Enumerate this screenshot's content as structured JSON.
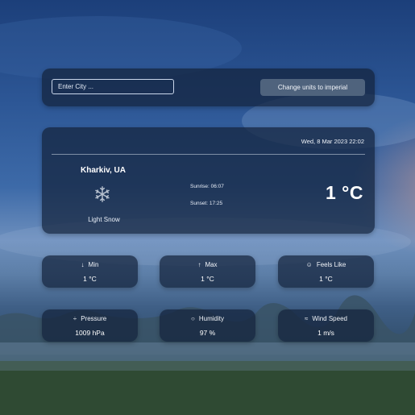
{
  "search": {
    "placeholder": "Enter City ..."
  },
  "toolbar": {
    "units_label": "Change units to imperial"
  },
  "current": {
    "datetime": "Wed, 8 Mar 2023 22:02",
    "city": "Kharkiv, UA",
    "icon": "snowflake-icon",
    "condition": "Light Snow",
    "sunrise": "Sunrise: 06:07",
    "sunset": "Sunset: 17:25",
    "temperature": "1 °C"
  },
  "details": [
    {
      "label": "Min",
      "icon": "arrow-down-icon",
      "value": "1 °C"
    },
    {
      "label": "Max",
      "icon": "arrow-up-icon",
      "value": "1 °C"
    },
    {
      "label": "Feels Like",
      "icon": "smiley-icon",
      "value": "1 °C"
    },
    {
      "label": "Pressure",
      "icon": "pressure-icon",
      "value": "1009 hPa"
    },
    {
      "label": "Humidity",
      "icon": "droplet-icon",
      "value": "97 %"
    },
    {
      "label": "Wind Speed",
      "icon": "wind-icon",
      "value": "1 m/s"
    }
  ]
}
